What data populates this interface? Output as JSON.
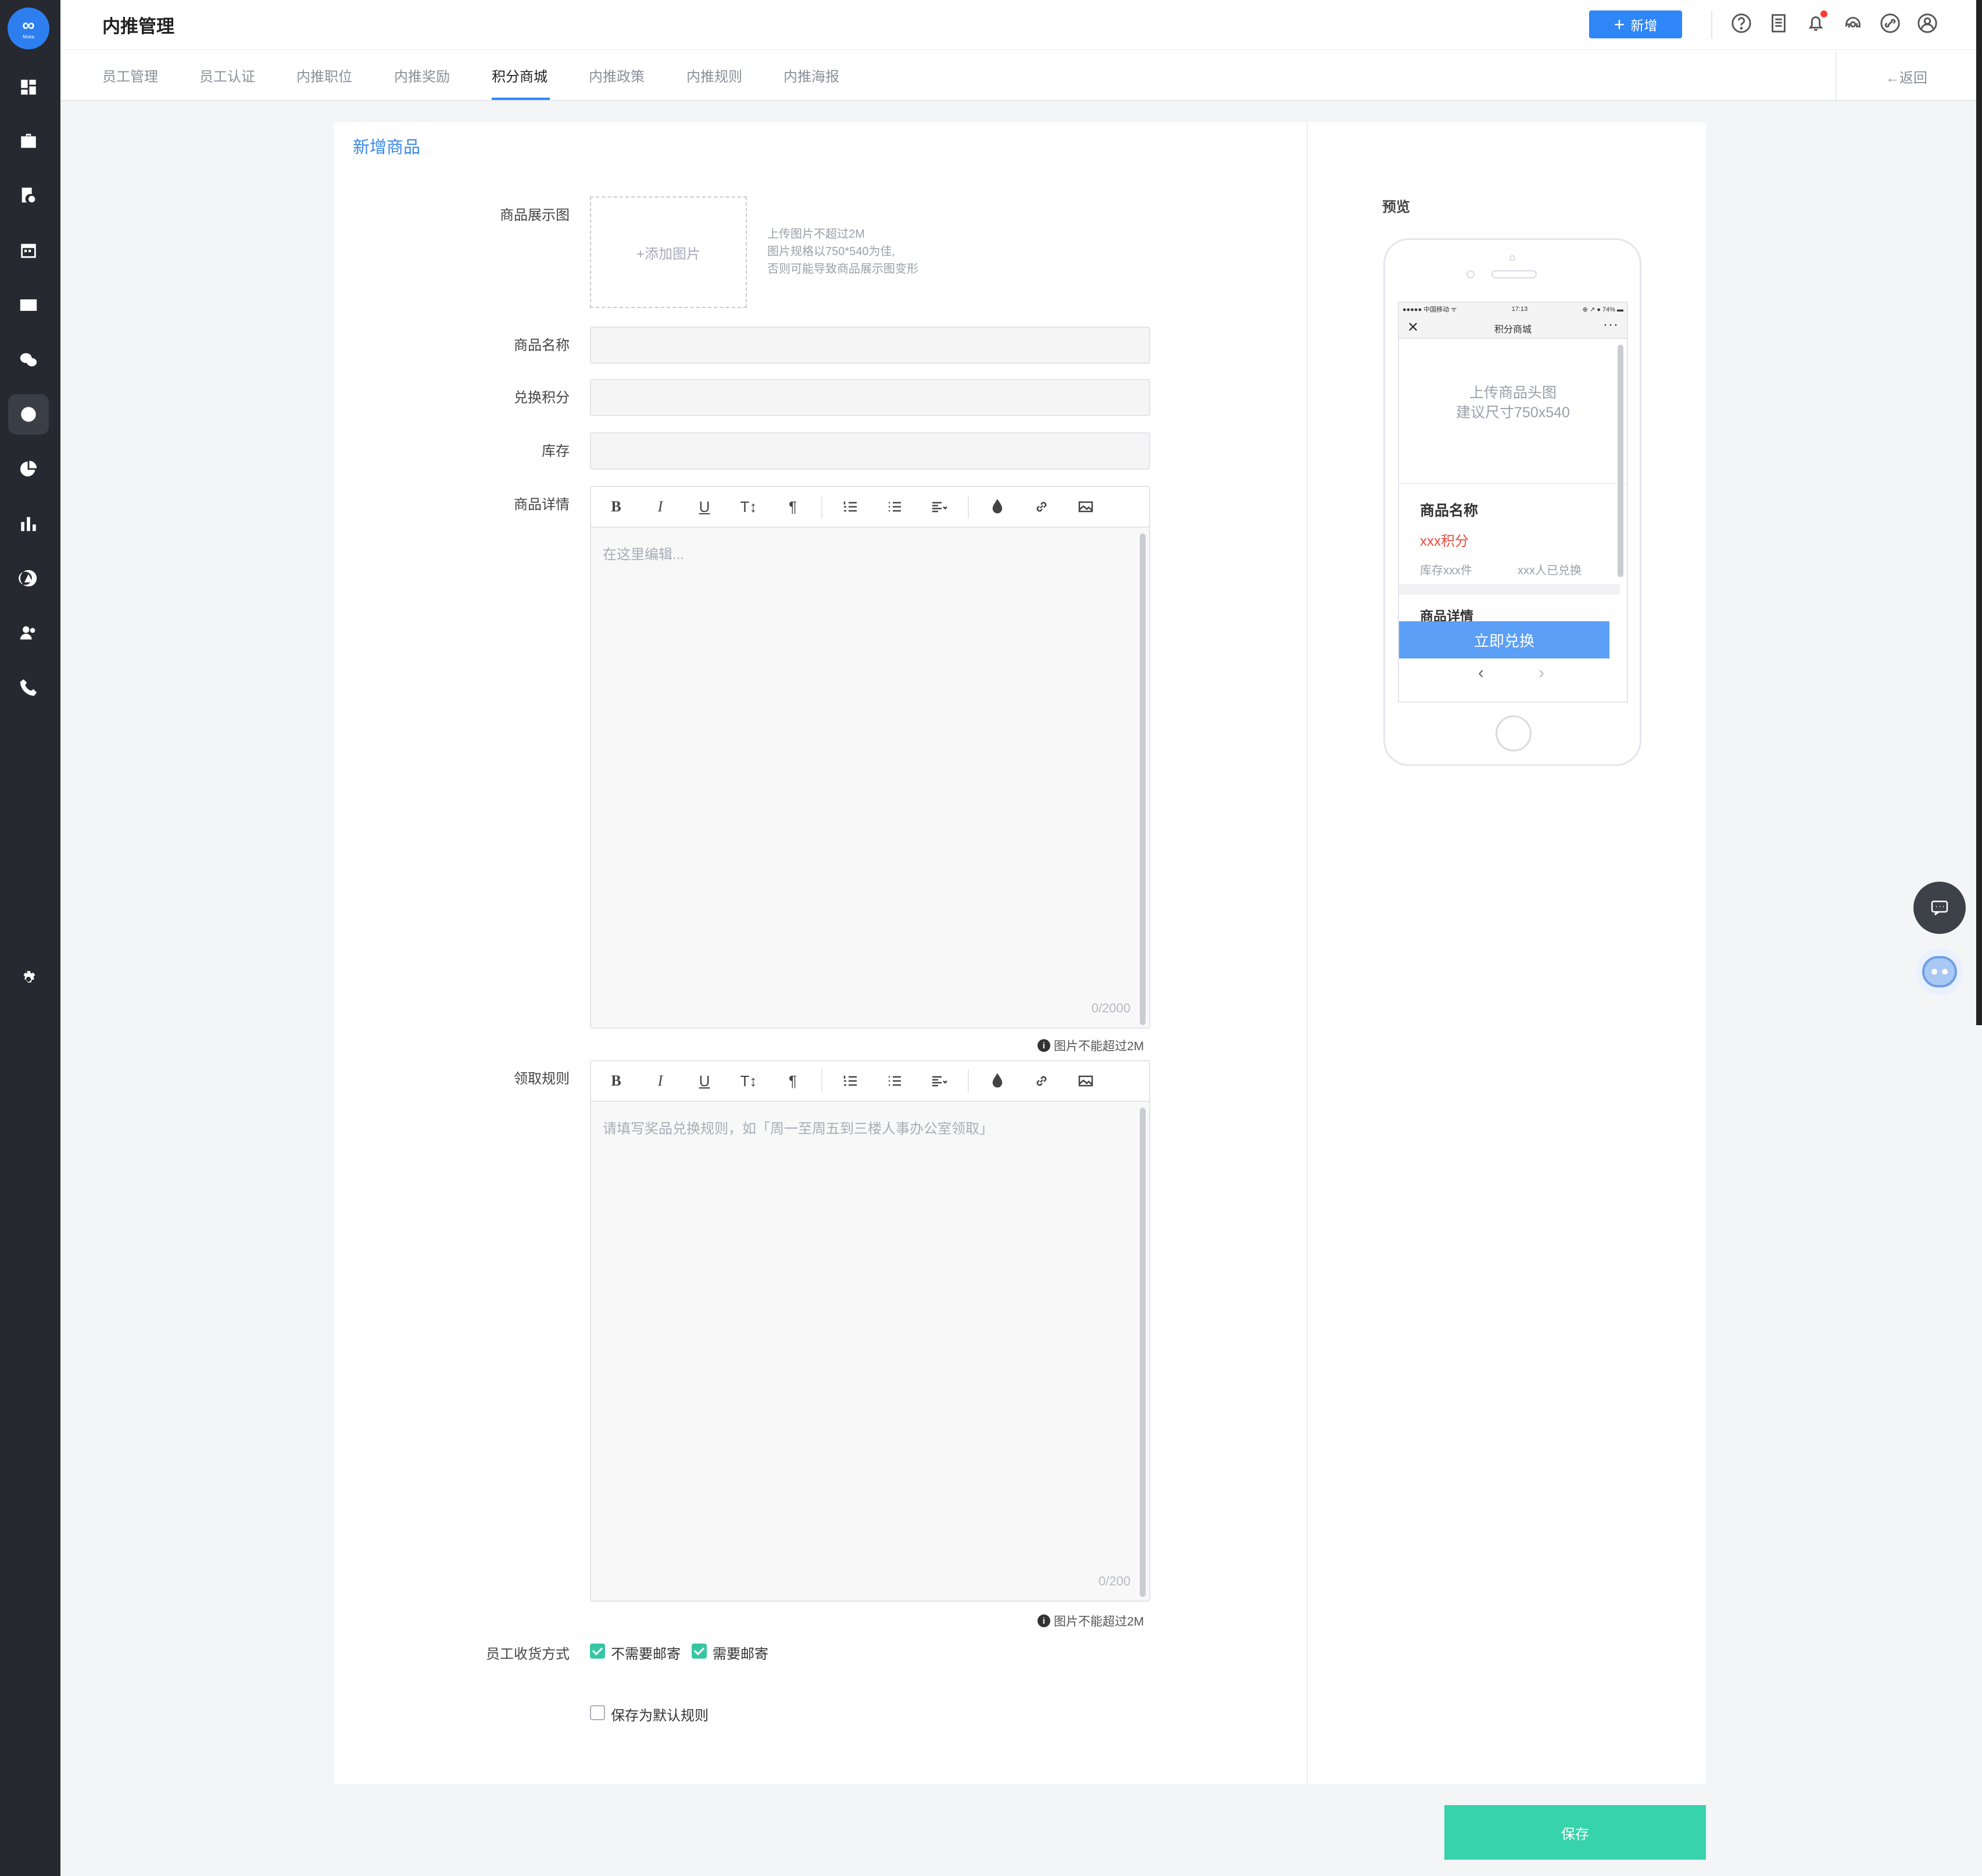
{
  "header": {
    "title": "内推管理",
    "add_button": "新增"
  },
  "tabs": [
    {
      "label": "员工管理"
    },
    {
      "label": "员工认证"
    },
    {
      "label": "内推职位"
    },
    {
      "label": "内推奖励"
    },
    {
      "label": "积分商城"
    },
    {
      "label": "内推政策"
    },
    {
      "label": "内推规则"
    },
    {
      "label": "内推海报"
    }
  ],
  "active_tab": "积分商城",
  "back_label": "←返回",
  "form": {
    "title": "新增商品",
    "image_label": "商品展示图",
    "image_upload": "+添加图片",
    "image_hint": [
      "上传图片不超过2M",
      "图片规格以750*540为佳,",
      "否则可能导致商品展示图变形"
    ],
    "name_label": "商品名称",
    "points_label": "兑换积分",
    "stock_label": "库存",
    "detail_label": "商品详情",
    "detail_placeholder": "在这里编辑...",
    "detail_count": "0/2000",
    "image_limit_hint": "图片不能超过2M",
    "rules_label": "领取规则",
    "rules_placeholder": "请填写奖品兑换规则，如「周一至周五到三楼人事办公室领取」",
    "rules_count": "0/200",
    "delivery_label": "员工收货方式",
    "delivery_options": [
      {
        "label": "不需要邮寄",
        "checked": true
      },
      {
        "label": "需要邮寄",
        "checked": true
      }
    ],
    "save_default": {
      "label": "保存为默认规则",
      "checked": false
    }
  },
  "toolbar": {
    "bold": "B",
    "italic": "I",
    "underline": "U",
    "font_size": "T↕",
    "paragraph": "¶"
  },
  "preview": {
    "label": "预览",
    "status_left": "●●●●● 中国移动 ᯤ",
    "status_time": "17:13",
    "status_right": "⊕ ↗ ● 74% ▬",
    "nav_close": "✕",
    "nav_title": "积分商城",
    "nav_more": "···",
    "image_placeholder": [
      "上传商品头图",
      "建议尺寸750x540"
    ],
    "product_name": "商品名称",
    "points": "xxx积分",
    "stock": "库存xxx件",
    "exchanged": "xxx人已兑换",
    "detail": "商品详情",
    "exchange_button": "立即兑换",
    "prev": "‹",
    "next": "›"
  },
  "save_button": "保存",
  "colors": {
    "primary": "#2f86f6",
    "save": "#36d3ac",
    "sidebar": "#26292f",
    "price_red": "#e84b3c",
    "check_green": "#36c6a4"
  },
  "icons": {
    "sidebar": [
      "dashboard-icon",
      "briefcase-icon",
      "document-search-icon",
      "calendar-icon",
      "id-card-icon",
      "wechat-icon",
      "points-icon",
      "pie-chart-icon",
      "bar-chart-icon",
      "user-circle-icon",
      "users-icon",
      "phone-icon",
      "settings-icon"
    ],
    "header": [
      "help-icon",
      "document-icon",
      "bell-icon",
      "support-icon",
      "link-icon",
      "user-icon"
    ]
  }
}
